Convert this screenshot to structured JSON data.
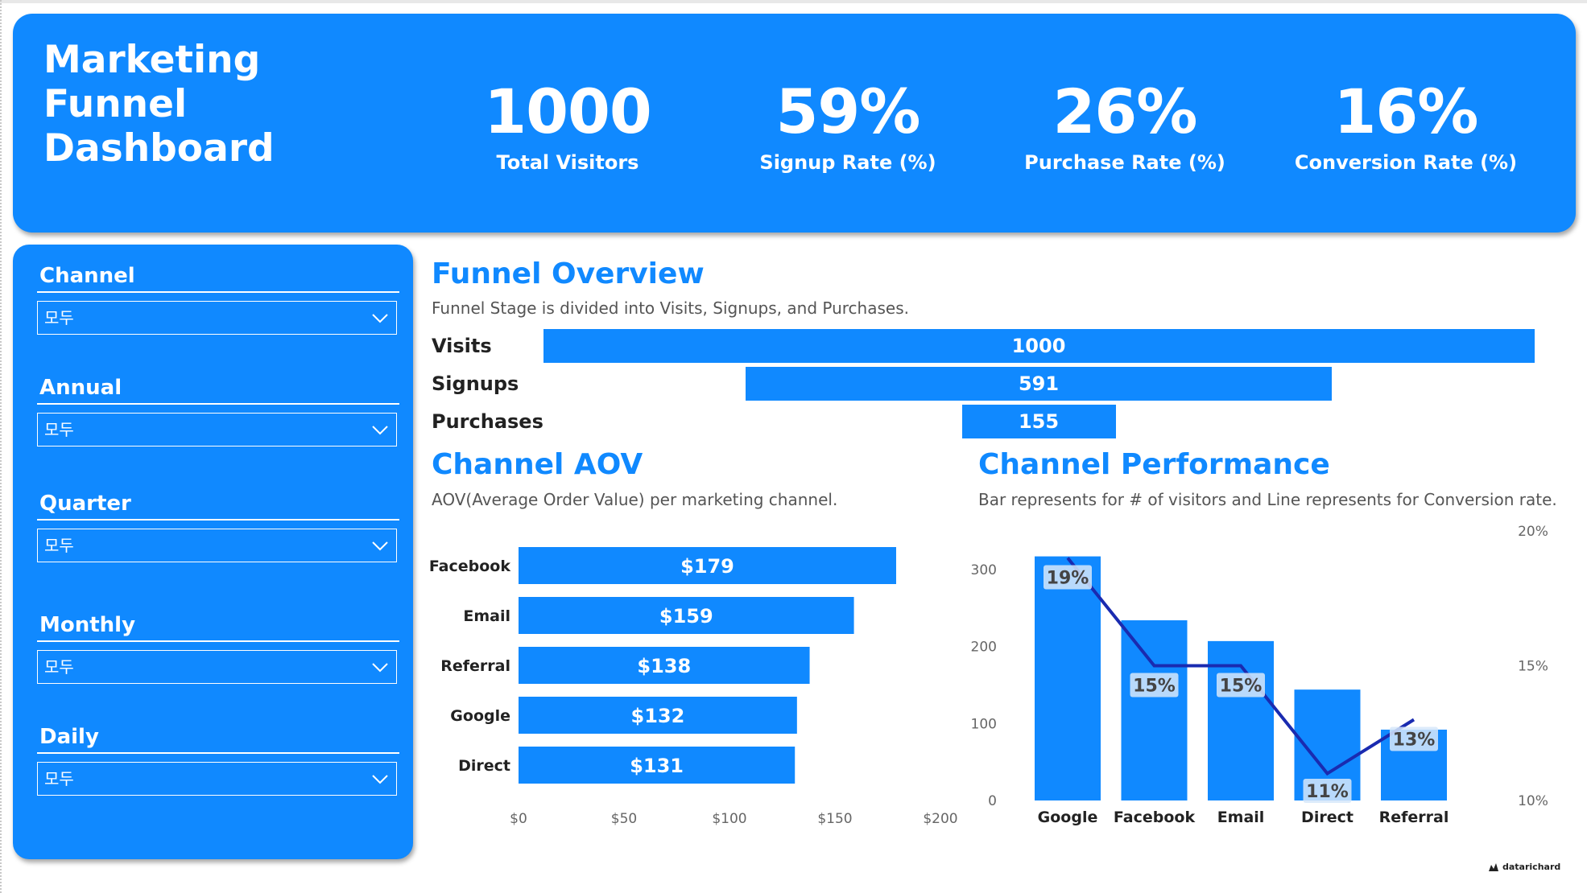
{
  "header": {
    "title": "Marketing\nFunnel\nDashboard",
    "kpis": [
      {
        "value": "1000",
        "label": "Total Visitors"
      },
      {
        "value": "59%",
        "label": "Signup Rate (%)"
      },
      {
        "value": "26%",
        "label": "Purchase Rate (%)"
      },
      {
        "value": "16%",
        "label": "Conversion Rate (%)"
      }
    ]
  },
  "slicers": [
    {
      "title": "Channel",
      "value": "모두"
    },
    {
      "title": "Annual",
      "value": "모두"
    },
    {
      "title": "Quarter",
      "value": "모두"
    },
    {
      "title": "Monthly",
      "value": "모두"
    },
    {
      "title": "Daily",
      "value": "모두"
    }
  ],
  "funnel": {
    "title": "Funnel Overview",
    "subtitle": "Funnel Stage is divided into Visits, Signups, and Purchases.",
    "stages": [
      {
        "label": "Visits",
        "value": 1000
      },
      {
        "label": "Signups",
        "value": 591
      },
      {
        "label": "Purchases",
        "value": 155
      }
    ]
  },
  "aov": {
    "title": "Channel AOV",
    "subtitle": "AOV(Average Order Value) per marketing channel."
  },
  "performance": {
    "title": "Channel Performance",
    "subtitle": "Bar represents for # of visitors and Line represents for Conversion rate."
  },
  "logo": "datarichard",
  "colors": {
    "accent": "#1089ff",
    "line": "#1a2bb0"
  },
  "chart_data": [
    {
      "type": "bar",
      "orientation": "horizontal",
      "categories": [
        "Facebook",
        "Email",
        "Referral",
        "Google",
        "Direct"
      ],
      "values": [
        179,
        159,
        138,
        132,
        131
      ],
      "data_labels": [
        "$179",
        "$159",
        "$138",
        "$132",
        "$131"
      ],
      "xlim": [
        0,
        200
      ],
      "x_ticks": [
        "$0",
        "$50",
        "$100",
        "$150",
        "$200"
      ],
      "grid": false
    },
    {
      "type": "bar",
      "categories": [
        "Google",
        "Facebook",
        "Email",
        "Direct",
        "Referral"
      ],
      "series": [
        {
          "values": [
            317,
            234,
            207,
            144,
            92
          ]
        },
        {
          "type": "line",
          "values": [
            19,
            15,
            15,
            11,
            13
          ],
          "axis": "right"
        }
      ],
      "data_labels": [
        "19%",
        "15%",
        "15%",
        "11%",
        "13%"
      ],
      "ylim": [
        0,
        350
      ],
      "y_ticks": [
        "0",
        "100",
        "200",
        "300"
      ],
      "y2lim": [
        10,
        20
      ],
      "y2_ticks": [
        "10%",
        "15%",
        "20%"
      ],
      "grid": false
    }
  ]
}
